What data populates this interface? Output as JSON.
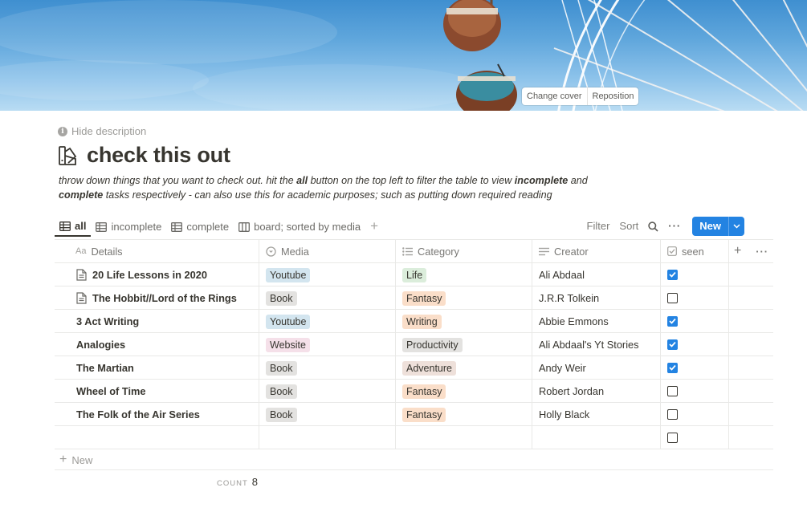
{
  "cover": {
    "change_cover": "Change cover",
    "reposition": "Reposition"
  },
  "page": {
    "hide_description": "Hide description",
    "icon": "color-swatch-icon",
    "title": "check this out",
    "description": {
      "p1": "throw down things that you want to check out. hit the ",
      "b1": "all",
      "p2": " button on the top left to filter the table to view ",
      "b2": "incomplete",
      "p3": " and ",
      "b3": "complete",
      "p4": " tasks respectively - can also use this for academic purposes; such as putting down required reading"
    }
  },
  "views": {
    "tabs": [
      {
        "label": "all",
        "icon": "table-icon",
        "active": true
      },
      {
        "label": "incomplete",
        "icon": "table-icon",
        "active": false
      },
      {
        "label": "complete",
        "icon": "table-icon",
        "active": false
      },
      {
        "label": "board; sorted by media",
        "icon": "board-icon",
        "active": false
      }
    ]
  },
  "toolbar": {
    "filter": "Filter",
    "sort": "Sort",
    "new_label": "New"
  },
  "table": {
    "columns": [
      {
        "label": "Details",
        "icon": "text-icon",
        "icon_text": "Aa"
      },
      {
        "label": "Media",
        "icon": "select-icon"
      },
      {
        "label": "Category",
        "icon": "list-icon"
      },
      {
        "label": "Creator",
        "icon": "text-lines-icon"
      },
      {
        "label": "seen",
        "icon": "checkbox-icon"
      }
    ],
    "rows": [
      {
        "details": "20 Life Lessons in 2020",
        "doc": true,
        "media": "Youtube",
        "category": "Life",
        "creator": "Ali Abdaal",
        "seen": true
      },
      {
        "details": "The Hobbit//Lord of the Rings",
        "doc": true,
        "media": "Book",
        "category": "Fantasy",
        "creator": "J.R.R Tolkein",
        "seen": false
      },
      {
        "details": "3 Act Writing",
        "doc": false,
        "media": "Youtube",
        "category": "Writing",
        "creator": "Abbie Emmons",
        "seen": true
      },
      {
        "details": "Analogies",
        "doc": false,
        "media": "Website",
        "category": "Productivity",
        "creator": "Ali Abdaal's Yt Stories",
        "seen": true
      },
      {
        "details": "The Martian",
        "doc": false,
        "media": "Book",
        "category": "Adventure",
        "creator": "Andy Weir",
        "seen": true
      },
      {
        "details": "Wheel of Time",
        "doc": false,
        "media": "Book",
        "category": "Fantasy",
        "creator": "Robert Jordan",
        "seen": false
      },
      {
        "details": "The Folk of the Air Series",
        "doc": false,
        "media": "Book",
        "category": "Fantasy",
        "creator": "Holly Black",
        "seen": false
      },
      {
        "details": "",
        "doc": false,
        "media": "",
        "category": "",
        "creator": "",
        "seen": false
      }
    ],
    "tag_colors": {
      "Youtube": "#d3e5ef",
      "Book": "#e3e2e0",
      "Website": "#f5e0e9",
      "Life": "#dbeddb",
      "Fantasy": "#fadec9",
      "Writing": "#fadec9",
      "Productivity": "#e3e2e0",
      "Adventure": "#eee0da"
    },
    "add_new": "New",
    "count_label": "COUNT",
    "count_value": "8"
  }
}
